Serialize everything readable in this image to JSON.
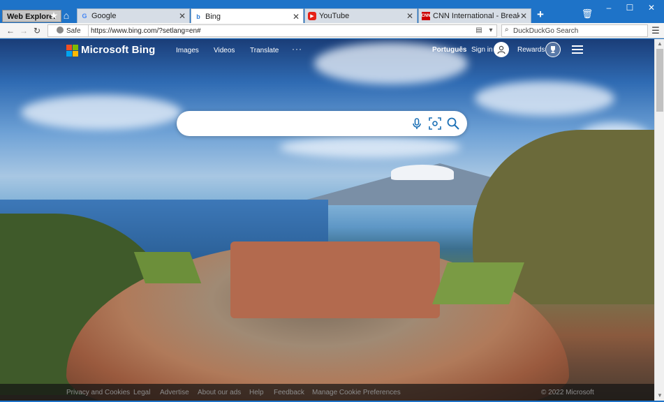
{
  "window": {
    "app_label": "Web Explorer",
    "controls": {
      "minimize": "–",
      "maximize": "☐",
      "close": "✕"
    },
    "new_tab": "+"
  },
  "tabs": [
    {
      "title": "Google",
      "favicon": "google-icon",
      "favicon_color": "#4285f4",
      "active": false
    },
    {
      "title": "Bing",
      "favicon": "bing-icon",
      "favicon_color": "#2f7bd3",
      "active": true
    },
    {
      "title": "YouTube",
      "favicon": "youtube-icon",
      "favicon_color": "#e62117",
      "active": false
    },
    {
      "title": "CNN International - Breaking News",
      "favicon": "cnn-icon",
      "favicon_color": "#cc0000",
      "active": false
    }
  ],
  "toolbar": {
    "security": "Safe",
    "url": "https://www.bing.com/?setlang=en#",
    "search_placeholder": "DuckDuckGo Search"
  },
  "bing": {
    "logo": "Microsoft Bing",
    "nav": [
      "Images",
      "Videos",
      "Translate"
    ],
    "more": "···",
    "language": "Português",
    "sign_in": "Sign in",
    "rewards": "Rewards",
    "search_placeholder": ""
  },
  "footer": {
    "links": [
      "Privacy and Cookies",
      "Legal",
      "Advertise",
      "About our ads",
      "Help",
      "Feedback",
      "Manage Cookie Preferences"
    ],
    "copyright": "© 2022 Microsoft"
  },
  "colors": {
    "window_chrome": "#1e73c8",
    "ms_red": "#f25022",
    "ms_green": "#7fba00",
    "ms_blue": "#00a4ef",
    "ms_yellow": "#ffb900"
  }
}
